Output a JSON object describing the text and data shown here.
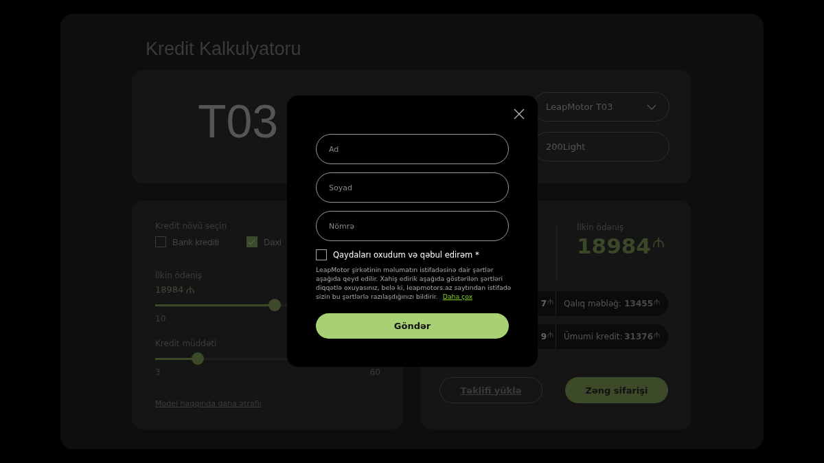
{
  "page_title": "Kredit Kalkulyatoru",
  "model_card": {
    "model_name": "T03",
    "selects": [
      {
        "kind": "dropdown",
        "value": "LeapMotor T03"
      },
      {
        "kind": "field",
        "value": "200Light"
      }
    ]
  },
  "calculator": {
    "credit_type_label": "Kredit növü seçin",
    "credit_types": [
      {
        "label": "Bank krediti",
        "checked": false
      },
      {
        "label": "Daxi",
        "checked": true
      }
    ],
    "sliders": [
      {
        "label": "İlkin ödəniş",
        "value": "18984",
        "level": 0.53,
        "min": "10"
      },
      {
        "label": "Kredit müddəti",
        "level": 0.19,
        "min": "3",
        "max": "60"
      }
    ],
    "more_link": "Model haqqında daha ətraflı"
  },
  "summary": {
    "down_payment_label": "İlkin ödəniş",
    "down_payment_value": "18984",
    "rows": [
      {
        "left_value": "7",
        "right_label": "Qalıq məbləğ:",
        "right_value": "13455"
      },
      {
        "left_value": "9",
        "right_label": "Ümumi kredit:",
        "right_value": "31376"
      }
    ],
    "buttons": [
      {
        "kind": "outline",
        "label": "Təklifi yüklə"
      },
      {
        "kind": "filled",
        "label": "Zəng sifarişi"
      }
    ]
  },
  "modal": {
    "fields": [
      {
        "placeholder": "Ad"
      },
      {
        "placeholder": "Soyad"
      },
      {
        "placeholder": "Nömrə"
      }
    ],
    "consent": {
      "label": "Qaydaları oxudum və qəbul edirəm *",
      "checked": false
    },
    "terms_text": "LeapMotor şirkətinin məlumatın istifadəsinə dair şərtlər aşağıda qeyd edilir. Xahiş edirik aşağıda göstərilən şərtləri diqqətlə oxuyasınız, belə ki, leapmotors.az saytından istifadə sizin bu şərtlərlə razılaşdığınızı bildirir.",
    "terms_link": "Daha çox",
    "submit": "Göndər"
  }
}
